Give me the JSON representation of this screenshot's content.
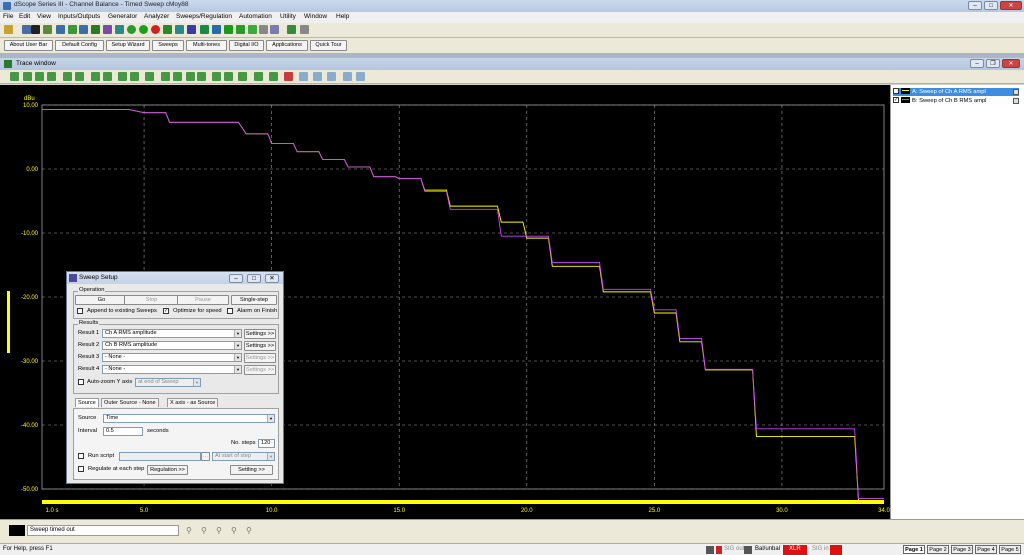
{
  "app_title": "dScope Series III - Channel Balance - Timed Sweep cMoy88",
  "menu": [
    "File",
    "Edit",
    "View",
    "Inputs/Outputs",
    "Generator",
    "Analyzer",
    "Sweeps/Regulation",
    "Automation",
    "Utility",
    "Window",
    "Help"
  ],
  "quick_buttons": [
    "About User Bar",
    "Default Config",
    "Setup Wizard",
    "Sweeps",
    "Multi-tones",
    "Digital I/O",
    "Applications",
    "Quick Tour"
  ],
  "trace_window_title": "Trace window",
  "graph": {
    "y_unit": "dBu",
    "y_ticks": [
      "10.00",
      "0.00",
      "-10.00",
      "-20.00",
      "-30.00",
      "-40.00",
      "-50.00"
    ],
    "x_ticks": [
      "1.0 s",
      "5.0",
      "10.0",
      "15.0",
      "20.0",
      "25.0",
      "30.0",
      "34.0"
    ]
  },
  "chart_data": {
    "type": "line",
    "ylabel": "dBu",
    "xlim": [
      1,
      34
    ],
    "ylim": [
      -52,
      10
    ],
    "series": [
      {
        "name": "A Sweep of Ch A RMS ampl",
        "color": "#ffff00",
        "x": [
          1,
          5,
          6,
          7,
          9,
          10,
          11,
          12,
          13,
          14,
          15,
          16,
          17,
          18,
          19,
          20,
          21,
          22,
          23,
          24,
          25,
          26,
          27,
          28,
          29,
          30,
          31,
          32,
          33,
          34
        ],
        "values": [
          9.3,
          8.8,
          7.3,
          7.3,
          5.5,
          4.0,
          2.7,
          1.5,
          0.3,
          -1.2,
          -1.5,
          -3.3,
          -5.8,
          -5.8,
          -8.3,
          -10.8,
          -15.2,
          -15.2,
          -19.2,
          -19.2,
          -22.5,
          -27.0,
          -31.4,
          -31.4,
          -41.8,
          -41.8,
          -41.8,
          -41.8,
          -51.8,
          -51.8
        ]
      },
      {
        "name": "B Sweep of Ch B RMS ampl",
        "color": "#cc44ff",
        "x": [
          1,
          5,
          6,
          7,
          9,
          10,
          11,
          12,
          13,
          14,
          15,
          16,
          17,
          18,
          19,
          20,
          21,
          22,
          23,
          24,
          25,
          26,
          27,
          28,
          29,
          30,
          31,
          32,
          33,
          34
        ],
        "values": [
          9.3,
          8.8,
          7.3,
          7.3,
          5.5,
          4.0,
          2.7,
          1.5,
          0.3,
          -1.2,
          -1.5,
          -3.5,
          -6.3,
          -6.3,
          -10.5,
          -10.5,
          -14.6,
          -14.6,
          -18.8,
          -18.8,
          -22.0,
          -26.5,
          -31.3,
          -31.3,
          -40.6,
          -40.6,
          -40.6,
          -40.6,
          -51.5,
          -51.5
        ]
      }
    ]
  },
  "legend": [
    {
      "check": "✓",
      "label": "A: Sweep of Ch A RMS ampl",
      "color": "#ffff00"
    },
    {
      "check": "✓",
      "label": "B: Sweep of Ch B RMS ampl",
      "color": "#cc44ff"
    }
  ],
  "dialog": {
    "title": "Sweep Setup",
    "operation_label": "Operation",
    "go": "Go",
    "stop": "Stop",
    "pause": "Pause",
    "single_step": "Single-step",
    "append_label": "Append to existing Sweeps",
    "optimize_label": "Optimize for speed",
    "alarm_label": "Alarm on Finish",
    "results_label": "Results",
    "results": [
      {
        "label": "Result 1",
        "value": "Ch A RMS amplitude",
        "settings": "Settings >>"
      },
      {
        "label": "Result 2",
        "value": "Ch B RMS amplitude",
        "settings": "Settings >>"
      },
      {
        "label": "Result 3",
        "value": "- None -",
        "settings": "Settings >>"
      },
      {
        "label": "Result 4",
        "value": "- None -",
        "settings": "Settings >>"
      }
    ],
    "autozoom_label": "Auto-zoom Y axis",
    "autozoom_value": "at end of Sweep",
    "tabs": [
      "Source",
      "Outer Source - None",
      "X axis - as Source"
    ],
    "source_label": "Source",
    "source_value": "Time",
    "interval_label": "Interval",
    "interval_value": "0.5",
    "interval_unit": "seconds",
    "nsteps_label": "No. steps",
    "nsteps_value": "120",
    "run_script_label": "Run script",
    "run_script_when": "At start of step",
    "regulate_label": "Regulate at each step",
    "regulation_btn": "Regulation >>",
    "settling_btn": "Settling >>"
  },
  "status_strip": {
    "message": "Sweep timed out"
  },
  "statusbar": {
    "help": "For Help, press F1",
    "sig_out": "SIG out",
    "bal": "Bal/unbal",
    "xlr": "XLR",
    "sig_in": "SIG in",
    "pages": [
      "Page 1",
      "Page 2",
      "Page 3",
      "Page 4",
      "Page 5"
    ]
  }
}
